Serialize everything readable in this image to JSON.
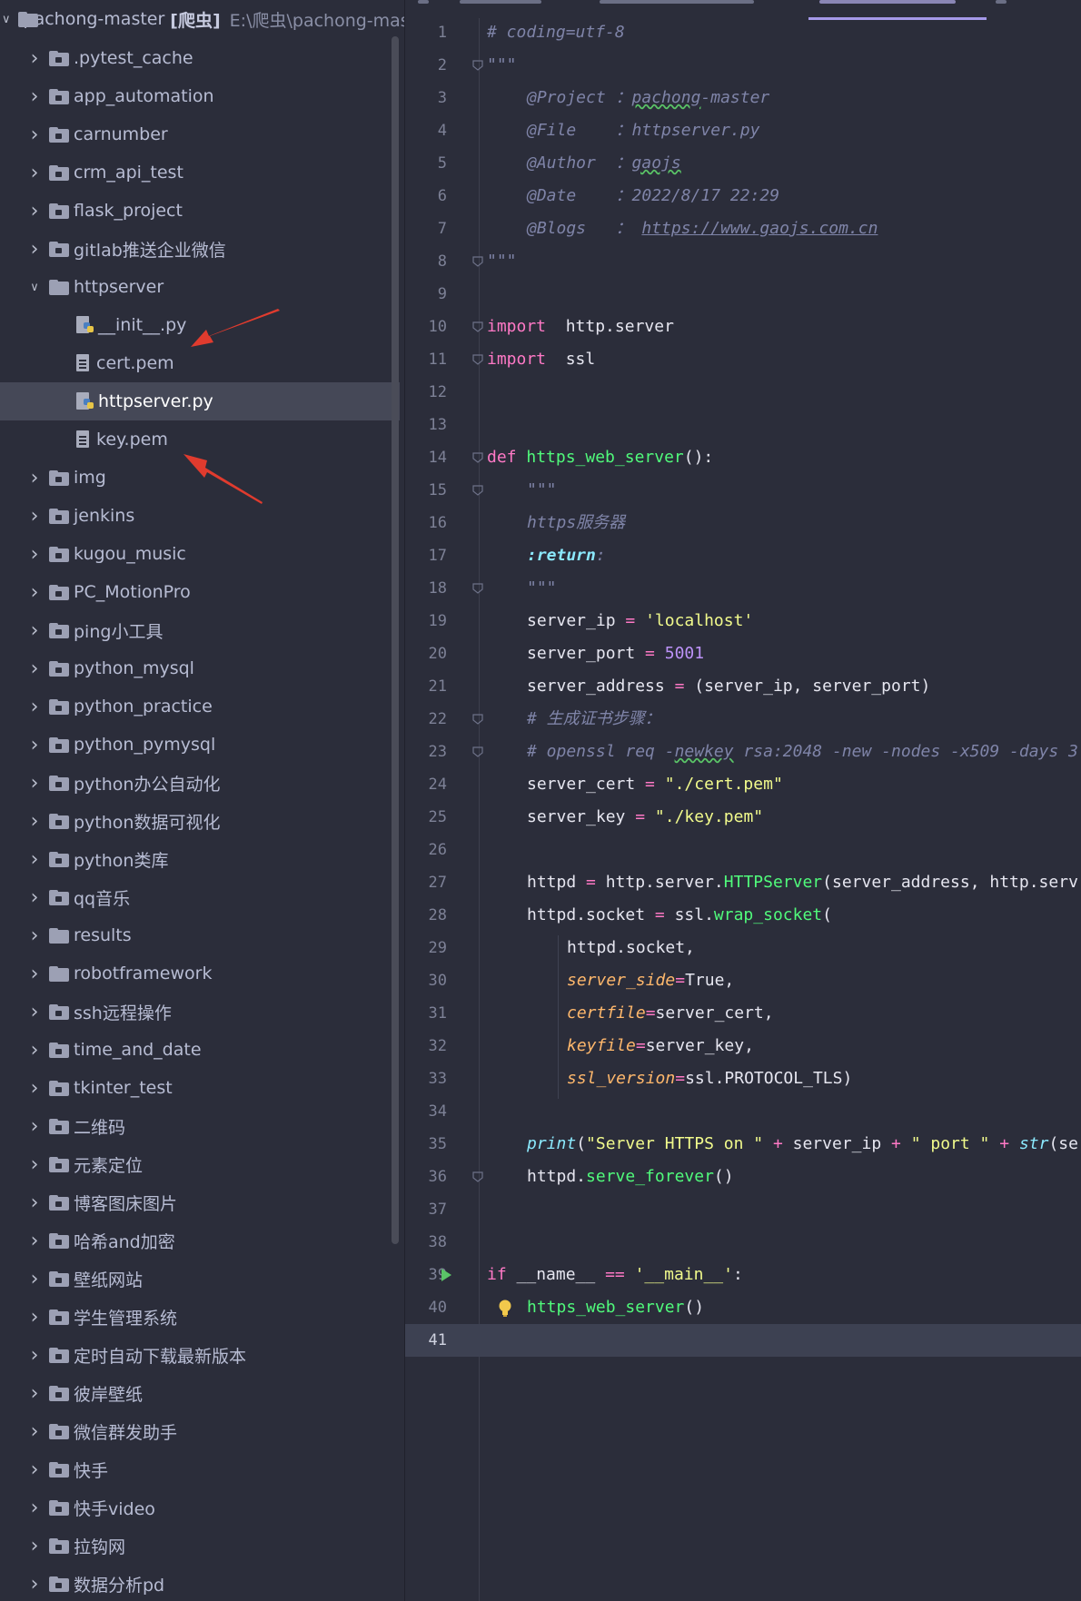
{
  "project": {
    "name": "pachong-master",
    "badge": "[爬虫]",
    "path": "E:\\爬虫\\pachong-master"
  },
  "tree": [
    {
      "label": ".pytest_cache",
      "type": "folder"
    },
    {
      "label": "app_automation",
      "type": "folder"
    },
    {
      "label": "carnumber",
      "type": "folder"
    },
    {
      "label": "crm_api_test",
      "type": "folder"
    },
    {
      "label": "flask_project",
      "type": "folder"
    },
    {
      "label": "gitlab推送企业微信",
      "type": "folder"
    },
    {
      "label": "httpserver",
      "type": "folder-open"
    },
    {
      "label": "__init__.py",
      "type": "py"
    },
    {
      "label": "cert.pem",
      "type": "file"
    },
    {
      "label": "httpserver.py",
      "type": "py",
      "selected": true
    },
    {
      "label": "key.pem",
      "type": "file"
    },
    {
      "label": "img",
      "type": "folder"
    },
    {
      "label": "jenkins",
      "type": "folder"
    },
    {
      "label": "kugou_music",
      "type": "folder"
    },
    {
      "label": "PC_MotionPro",
      "type": "folder"
    },
    {
      "label": "ping小工具",
      "type": "folder"
    },
    {
      "label": "python_mysql",
      "type": "folder"
    },
    {
      "label": "python_practice",
      "type": "folder"
    },
    {
      "label": "python_pymysql",
      "type": "folder"
    },
    {
      "label": "python办公自动化",
      "type": "folder"
    },
    {
      "label": "python数据可视化",
      "type": "folder"
    },
    {
      "label": "python类库",
      "type": "folder"
    },
    {
      "label": "qq音乐",
      "type": "folder"
    },
    {
      "label": "results",
      "type": "folder-plain"
    },
    {
      "label": "robotframework",
      "type": "folder-plain"
    },
    {
      "label": "ssh远程操作",
      "type": "folder"
    },
    {
      "label": "time_and_date",
      "type": "folder"
    },
    {
      "label": "tkinter_test",
      "type": "folder"
    },
    {
      "label": "二维码",
      "type": "folder"
    },
    {
      "label": "元素定位",
      "type": "folder"
    },
    {
      "label": "博客图床图片",
      "type": "folder"
    },
    {
      "label": "哈希and加密",
      "type": "folder"
    },
    {
      "label": "壁纸网站",
      "type": "folder"
    },
    {
      "label": "学生管理系统",
      "type": "folder"
    },
    {
      "label": "定时自动下载最新版本",
      "type": "folder"
    },
    {
      "label": "彼岸壁纸",
      "type": "folder"
    },
    {
      "label": "微信群发助手",
      "type": "folder"
    },
    {
      "label": "快手",
      "type": "folder"
    },
    {
      "label": "快手video",
      "type": "folder"
    },
    {
      "label": "拉钩网",
      "type": "folder"
    },
    {
      "label": "数据分析pd",
      "type": "folder"
    }
  ],
  "code": [
    {
      "n": "1",
      "i": 0,
      "fold": false,
      "segs": [
        [
          "c-com",
          "# coding=utf-8"
        ]
      ]
    },
    {
      "n": "2",
      "i": 0,
      "fold": true,
      "segs": [
        [
          "c-doc",
          "\"\"\""
        ]
      ]
    },
    {
      "n": "3",
      "i": 1,
      "fold": false,
      "segs": [
        [
          "c-doc",
          "@Project ："
        ],
        [
          "c-doc u-wavy",
          "pachong"
        ],
        [
          "c-doc",
          "-master"
        ]
      ]
    },
    {
      "n": "4",
      "i": 1,
      "fold": false,
      "segs": [
        [
          "c-doc",
          "@File    ：httpserver.py"
        ]
      ]
    },
    {
      "n": "5",
      "i": 1,
      "fold": false,
      "segs": [
        [
          "c-doc",
          "@Author  ："
        ],
        [
          "c-doc u-wavy",
          "gaojs"
        ]
      ]
    },
    {
      "n": "6",
      "i": 1,
      "fold": false,
      "segs": [
        [
          "c-doc",
          "@Date    ：2022/8/17 22:29"
        ]
      ]
    },
    {
      "n": "7",
      "i": 1,
      "fold": false,
      "segs": [
        [
          "c-doc",
          "@Blogs   ： "
        ],
        [
          "c-doc u-link",
          "https://www.gaojs.com.cn"
        ]
      ]
    },
    {
      "n": "8",
      "i": 0,
      "fold": true,
      "segs": [
        [
          "c-doc",
          "\"\"\""
        ]
      ]
    },
    {
      "n": "9",
      "i": 0,
      "fold": false,
      "segs": []
    },
    {
      "n": "10",
      "i": 0,
      "fold": true,
      "segs": [
        [
          "c-kw",
          "import"
        ],
        [
          "",
          "  http.server"
        ]
      ]
    },
    {
      "n": "11",
      "i": 0,
      "fold": true,
      "segs": [
        [
          "c-kw",
          "import"
        ],
        [
          "",
          "  ssl"
        ]
      ]
    },
    {
      "n": "12",
      "i": 0,
      "fold": false,
      "segs": []
    },
    {
      "n": "13",
      "i": 0,
      "fold": false,
      "segs": []
    },
    {
      "n": "14",
      "i": 0,
      "fold": true,
      "segs": [
        [
          "c-kw",
          "def"
        ],
        [
          "",
          " "
        ],
        [
          "c-fn",
          "https_web_server"
        ],
        [
          "",
          "():"
        ]
      ]
    },
    {
      "n": "15",
      "i": 1,
      "fold": true,
      "segs": [
        [
          "c-doc",
          "\"\"\""
        ]
      ]
    },
    {
      "n": "16",
      "i": 1,
      "fold": false,
      "segs": [
        [
          "c-doc",
          "https服务器"
        ]
      ]
    },
    {
      "n": "17",
      "i": 1,
      "fold": false,
      "segs": [
        [
          "c-doc-tag",
          ":return"
        ],
        [
          "c-doc",
          ":"
        ]
      ]
    },
    {
      "n": "18",
      "i": 1,
      "fold": true,
      "segs": [
        [
          "c-doc",
          "\"\"\""
        ]
      ]
    },
    {
      "n": "19",
      "i": 1,
      "fold": false,
      "segs": [
        [
          "",
          "server_ip "
        ],
        [
          "c-op",
          "="
        ],
        [
          "",
          " "
        ],
        [
          "c-str",
          "'localhost'"
        ]
      ]
    },
    {
      "n": "20",
      "i": 1,
      "fold": false,
      "segs": [
        [
          "",
          "server_port "
        ],
        [
          "c-op",
          "="
        ],
        [
          "",
          " "
        ],
        [
          "c-num",
          "5001"
        ]
      ]
    },
    {
      "n": "21",
      "i": 1,
      "fold": false,
      "segs": [
        [
          "",
          "server_address "
        ],
        [
          "c-op",
          "="
        ],
        [
          "",
          " (server_ip, server_port)"
        ]
      ]
    },
    {
      "n": "22",
      "i": 1,
      "fold": true,
      "segs": [
        [
          "c-com",
          "# 生成证书步骤："
        ]
      ]
    },
    {
      "n": "23",
      "i": 1,
      "fold": true,
      "segs": [
        [
          "c-com",
          "# openssl req -"
        ],
        [
          "c-com u-wavy",
          "newkey"
        ],
        [
          "c-com",
          " rsa:2048 -new -nodes -x509 -days 3"
        ]
      ]
    },
    {
      "n": "24",
      "i": 1,
      "fold": false,
      "segs": [
        [
          "",
          "server_cert "
        ],
        [
          "c-op",
          "="
        ],
        [
          "",
          " "
        ],
        [
          "c-str",
          "\"./cert.pem\""
        ]
      ]
    },
    {
      "n": "25",
      "i": 1,
      "fold": false,
      "segs": [
        [
          "",
          "server_key "
        ],
        [
          "c-op",
          "="
        ],
        [
          "",
          " "
        ],
        [
          "c-str",
          "\"./key.pem\""
        ]
      ]
    },
    {
      "n": "26",
      "i": 0,
      "fold": false,
      "segs": []
    },
    {
      "n": "27",
      "i": 1,
      "fold": false,
      "segs": [
        [
          "",
          "httpd "
        ],
        [
          "c-op",
          "="
        ],
        [
          "",
          " http.server."
        ],
        [
          "c-fn",
          "HTTPServer"
        ],
        [
          "",
          "(server_address, http.serv"
        ]
      ]
    },
    {
      "n": "28",
      "i": 1,
      "fold": false,
      "segs": [
        [
          "",
          "httpd.socket "
        ],
        [
          "c-op",
          "="
        ],
        [
          "",
          " ssl."
        ],
        [
          "c-fn",
          "wrap_socket"
        ],
        [
          "",
          "("
        ]
      ]
    },
    {
      "n": "29",
      "i": 2,
      "fold": false,
      "segs": [
        [
          "",
          "httpd.socket,"
        ]
      ]
    },
    {
      "n": "30",
      "i": 2,
      "fold": false,
      "segs": [
        [
          "c-param",
          "server_side"
        ],
        [
          "c-op",
          "="
        ],
        [
          "",
          "True,"
        ]
      ]
    },
    {
      "n": "31",
      "i": 2,
      "fold": false,
      "segs": [
        [
          "c-param",
          "certfile"
        ],
        [
          "c-op",
          "="
        ],
        [
          "",
          "server_cert,"
        ]
      ]
    },
    {
      "n": "32",
      "i": 2,
      "fold": false,
      "segs": [
        [
          "c-param",
          "keyfile"
        ],
        [
          "c-op",
          "="
        ],
        [
          "",
          "server_key,"
        ]
      ]
    },
    {
      "n": "33",
      "i": 2,
      "fold": false,
      "segs": [
        [
          "c-param",
          "ssl_version"
        ],
        [
          "c-op",
          "="
        ],
        [
          "",
          "ssl.PROTOCOL_TLS)"
        ]
      ]
    },
    {
      "n": "34",
      "i": 0,
      "fold": false,
      "segs": []
    },
    {
      "n": "35",
      "i": 1,
      "fold": false,
      "segs": [
        [
          "c-builtin",
          "print"
        ],
        [
          "",
          "("
        ],
        [
          "c-str",
          "\"Server HTTPS on \""
        ],
        [
          "",
          " "
        ],
        [
          "c-op",
          "+"
        ],
        [
          "",
          " server_ip "
        ],
        [
          "c-op",
          "+"
        ],
        [
          "",
          " "
        ],
        [
          "c-str",
          "\" port \""
        ],
        [
          "",
          " "
        ],
        [
          "c-op",
          "+"
        ],
        [
          "",
          " "
        ],
        [
          "c-builtin",
          "str"
        ],
        [
          "",
          "(se"
        ]
      ]
    },
    {
      "n": "36",
      "i": 1,
      "fold": true,
      "segs": [
        [
          "",
          "httpd."
        ],
        [
          "c-fn",
          "serve_forever"
        ],
        [
          "",
          "()"
        ]
      ]
    },
    {
      "n": "37",
      "i": 0,
      "fold": false,
      "segs": []
    },
    {
      "n": "38",
      "i": 0,
      "fold": false,
      "segs": []
    },
    {
      "n": "39",
      "i": 0,
      "fold": false,
      "run": true,
      "segs": [
        [
          "c-kw",
          "if"
        ],
        [
          "",
          " __name__ "
        ],
        [
          "c-op",
          "=="
        ],
        [
          "",
          " "
        ],
        [
          "c-str",
          "'__main__'"
        ],
        [
          "",
          ":"
        ]
      ]
    },
    {
      "n": "40",
      "i": 1,
      "fold": false,
      "bulb": true,
      "segs": [
        [
          "c-fn",
          "https_web_server"
        ],
        [
          "",
          "()"
        ]
      ]
    },
    {
      "n": "41",
      "i": 0,
      "fold": false,
      "current": true,
      "segs": []
    }
  ],
  "colors": {
    "accent": "#a599e9",
    "arrow": "#e03b2e",
    "selection": "#454857"
  }
}
